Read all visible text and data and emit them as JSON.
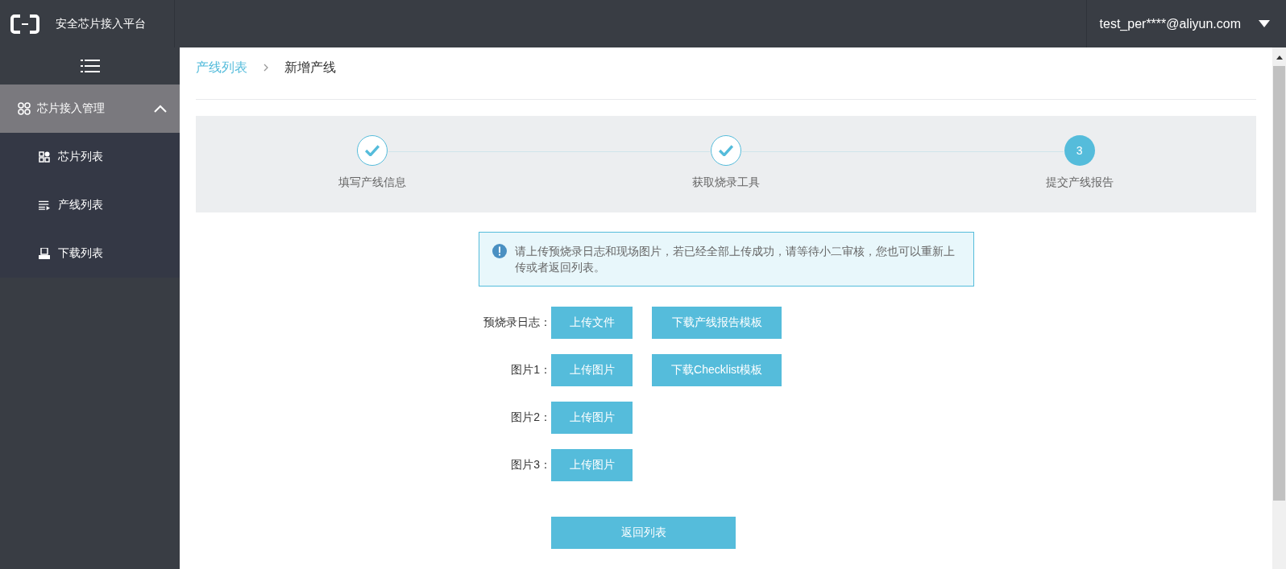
{
  "header": {
    "title": "安全芯片接入平台",
    "user": "test_per****@aliyun.com"
  },
  "sidebar": {
    "group": {
      "label": "芯片接入管理",
      "expanded": true
    },
    "items": [
      {
        "label": "芯片列表",
        "kind": "chips",
        "selected": false
      },
      {
        "label": "产线列表",
        "kind": "list",
        "selected": false
      },
      {
        "label": "下载列表",
        "kind": "download",
        "selected": false
      }
    ]
  },
  "breadcrumb": [
    {
      "label": "产线列表",
      "kind": "link"
    },
    {
      "label": "新增产线",
      "kind": "current"
    }
  ],
  "steps": [
    {
      "label": "填写产线信息",
      "done": true
    },
    {
      "label": "获取烧录工具",
      "done": true
    },
    {
      "label": "提交产线报告",
      "done": false,
      "number": "3"
    }
  ],
  "alert": {
    "text": "请上传预烧录日志和现场图片，若已经全部上传成功，请等待小二审核，您也可以重新上传或者返回列表。"
  },
  "form_rows": [
    {
      "label": "预烧录日志：",
      "buttons": [
        "上传文件",
        "下载产线报告模板"
      ]
    },
    {
      "label": "图片1：",
      "buttons": [
        "上传图片",
        "下载Checklist模板"
      ]
    },
    {
      "label": "图片2：",
      "buttons": [
        "上传图片"
      ]
    },
    {
      "label": "图片3：",
      "buttons": [
        "上传图片"
      ]
    }
  ],
  "back_button": "返回列表"
}
